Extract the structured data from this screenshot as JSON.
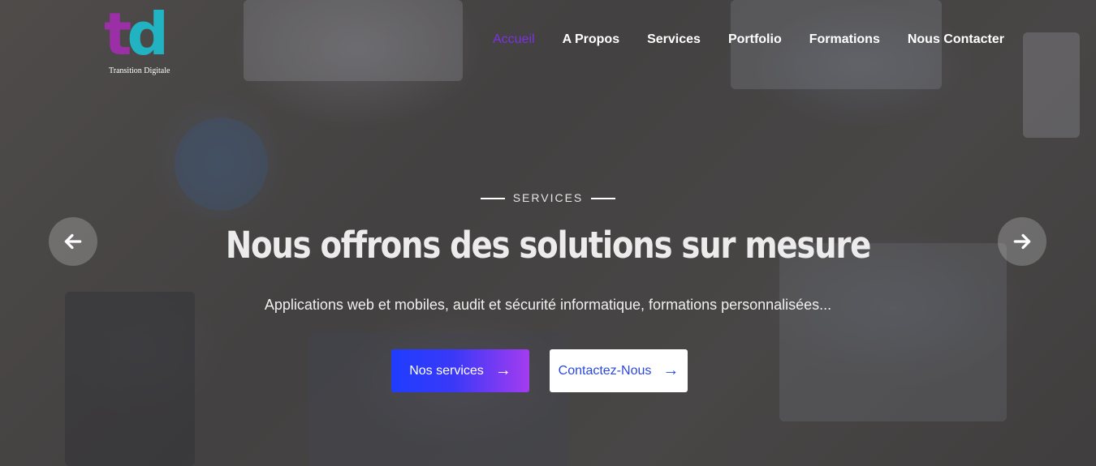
{
  "brand": {
    "tagline": "Transition Digitale"
  },
  "nav": {
    "items": [
      {
        "label": "Accueil",
        "active": true
      },
      {
        "label": "A Propos"
      },
      {
        "label": "Services"
      },
      {
        "label": "Portfolio"
      },
      {
        "label": "Formations"
      },
      {
        "label": "Nous Contacter"
      }
    ]
  },
  "hero": {
    "eyebrow": "SERVICES",
    "title": "Nous offrons des solutions sur mesure",
    "subtitle": "Applications web et mobiles, audit et sécurité informatique, formations personnalisées...",
    "primary_button": "Nos services",
    "secondary_button": "Contactez-Nous"
  },
  "carousel": {
    "prev_icon": "arrow-left-icon",
    "next_icon": "arrow-right-icon"
  },
  "colors": {
    "accent": "#7b33e0",
    "primary_gradient_start": "#1f3dff",
    "primary_gradient_end": "#a43cf0",
    "logo_t": "#9b2fa6",
    "logo_d": "#21b3c2"
  }
}
